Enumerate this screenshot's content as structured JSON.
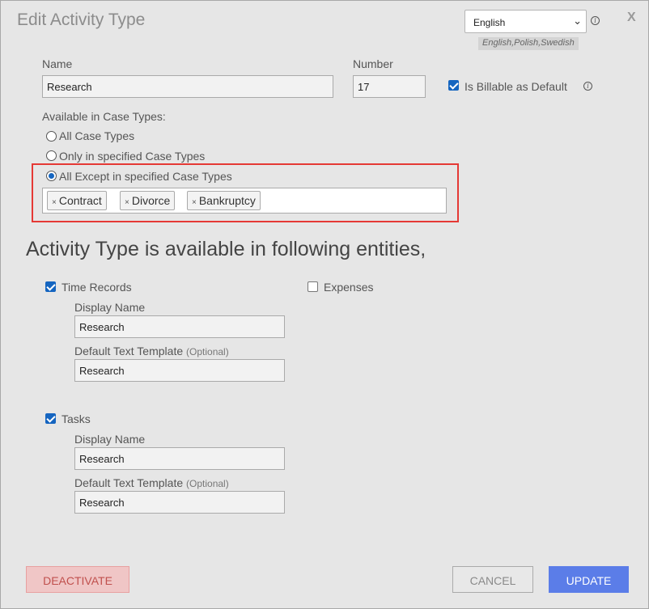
{
  "dialog": {
    "title": "Edit Activity Type",
    "close_label": "X"
  },
  "language": {
    "selected": "English",
    "available_list": "English,Polish,Swedish",
    "info_icon": "info-icon"
  },
  "form": {
    "name_label": "Name",
    "name_value": "Research",
    "number_label": "Number",
    "number_value": "17",
    "billable_label": "Is Billable as Default",
    "billable_checked": true
  },
  "case_types": {
    "label": "Available in Case Types:",
    "options": [
      {
        "label": "All Case Types",
        "selected": false
      },
      {
        "label": "Only in specified Case Types",
        "selected": false
      },
      {
        "label": "All Except in specified Case Types",
        "selected": true
      }
    ],
    "tags": [
      "Contract",
      "Divorce",
      "Bankruptcy"
    ],
    "tag_remove_glyph": "×"
  },
  "entities": {
    "heading": "Activity Type is available in following entities,",
    "time_records": {
      "label": "Time Records",
      "checked": true,
      "display_name_label": "Display Name",
      "display_name_value": "Research",
      "template_label": "Default Text Template",
      "template_optional": "(Optional)",
      "template_value": "Research"
    },
    "expenses": {
      "label": "Expenses",
      "checked": false
    },
    "tasks": {
      "label": "Tasks",
      "checked": true,
      "display_name_label": "Display Name",
      "display_name_value": "Research",
      "template_label": "Default Text Template",
      "template_optional": "(Optional)",
      "template_value": "Research"
    }
  },
  "buttons": {
    "deactivate": "DEACTIVATE",
    "cancel": "CANCEL",
    "update": "UPDATE"
  },
  "colors": {
    "accent": "#5b7de8",
    "danger": "#e53935",
    "checkbox": "#1565c0"
  }
}
